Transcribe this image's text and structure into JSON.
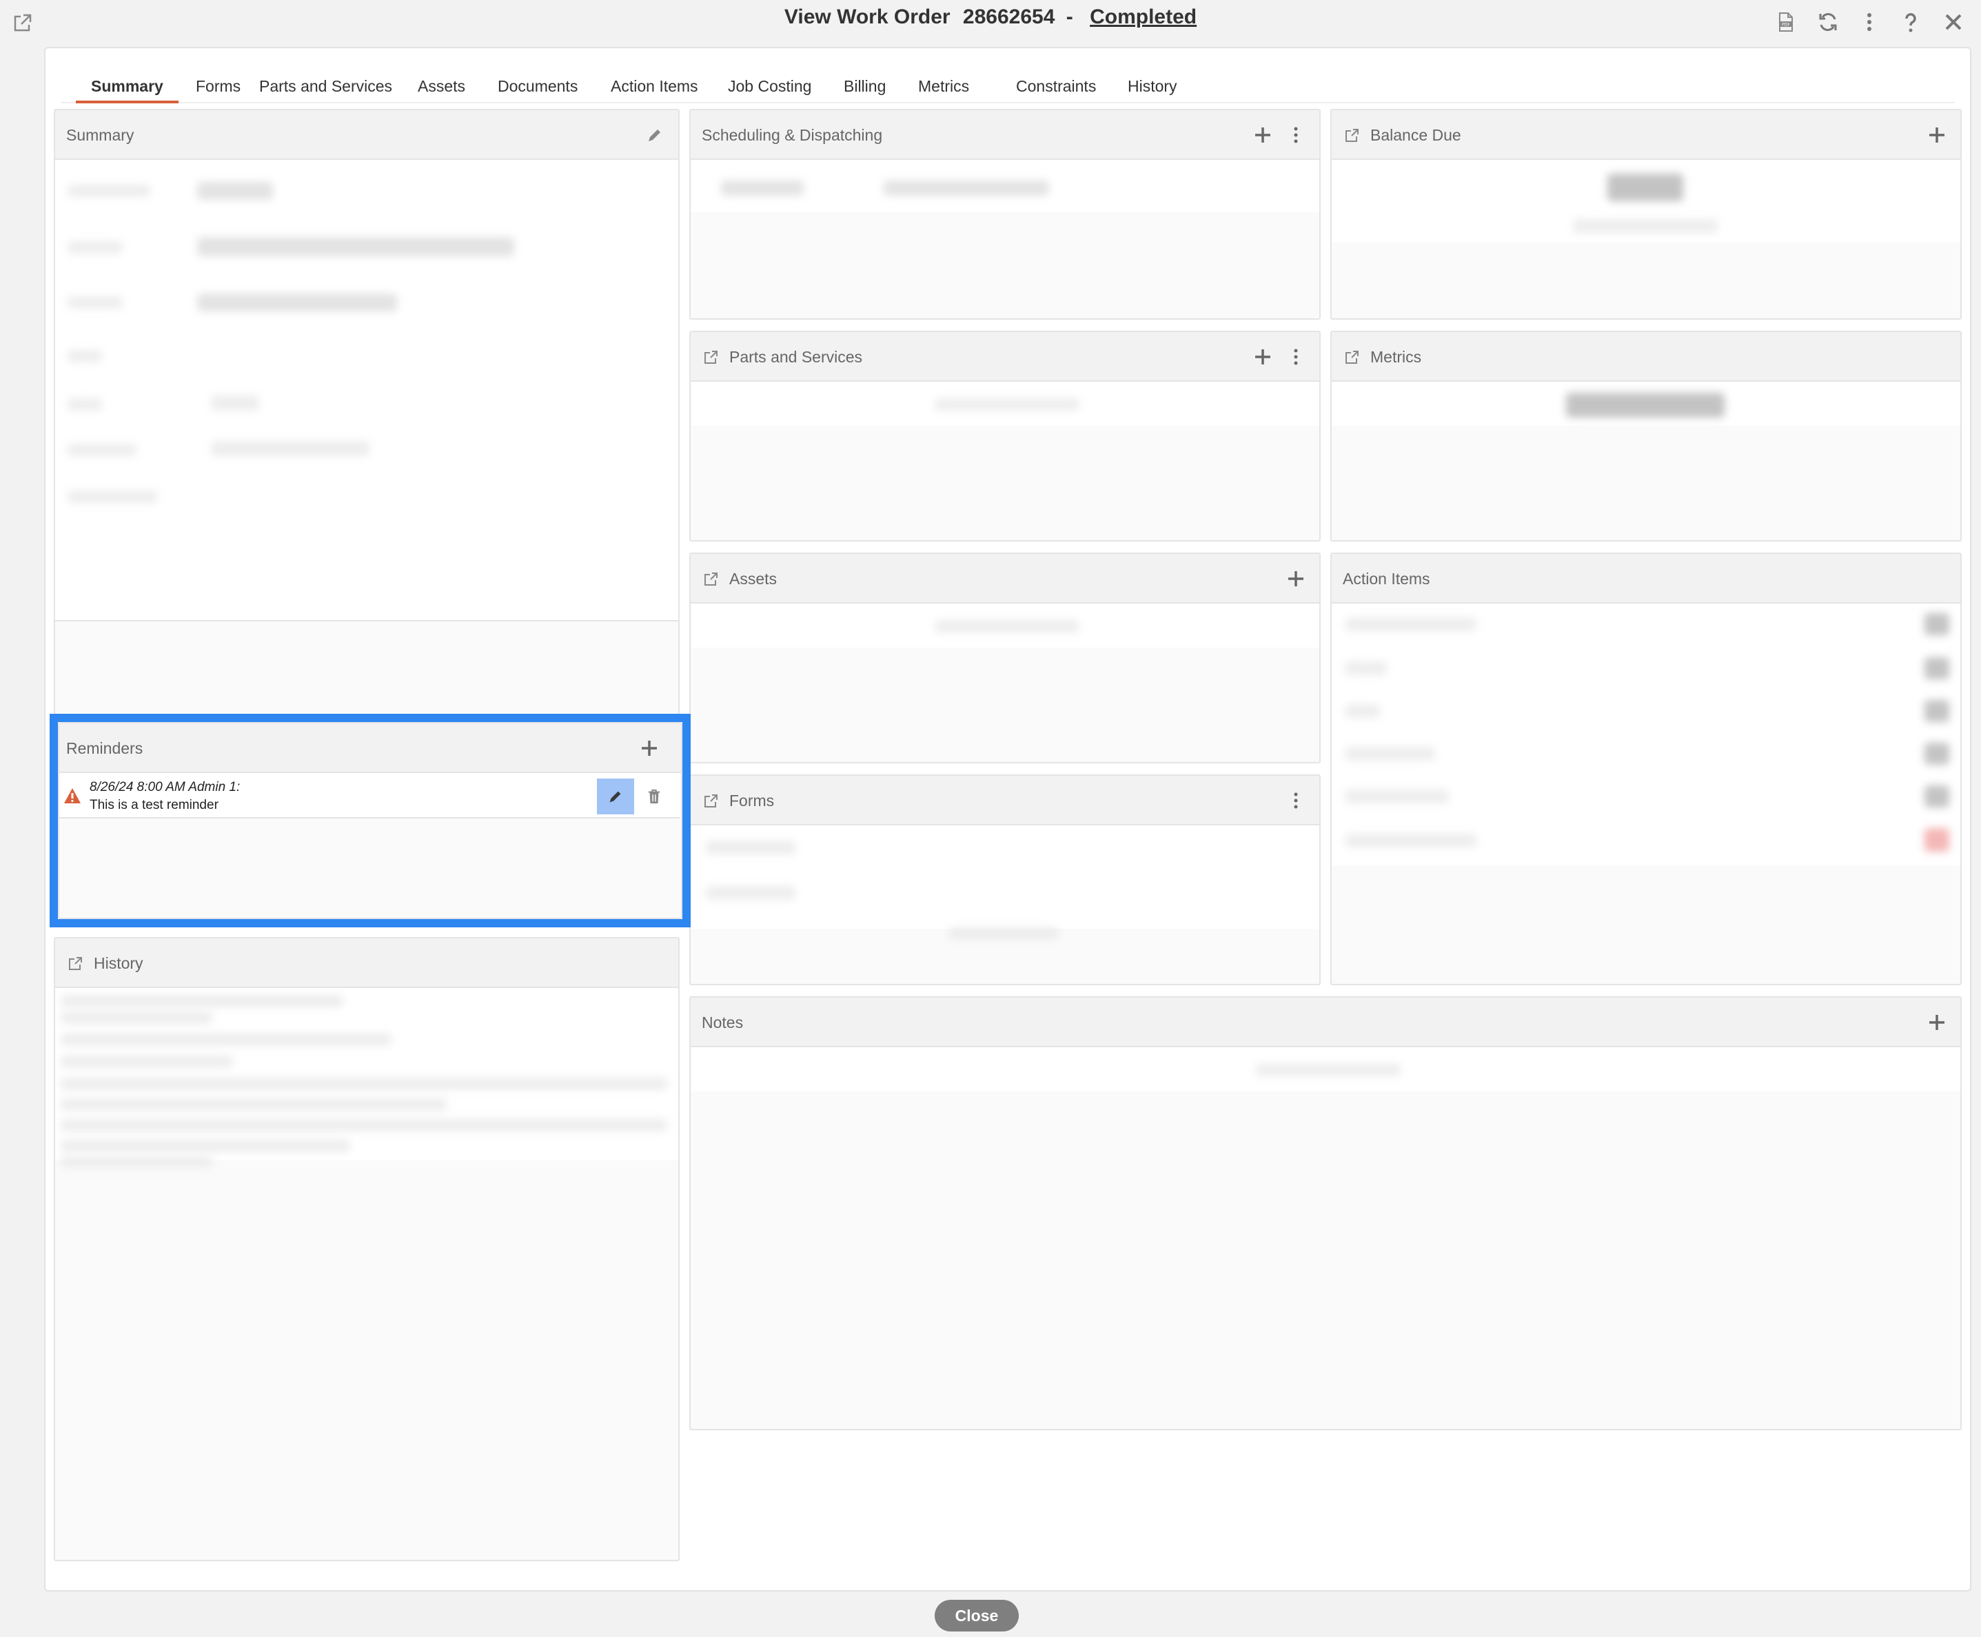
{
  "header": {
    "title_prefix": "View Work Order",
    "order_number": "28662654",
    "separator": "-",
    "status": "Completed"
  },
  "toolbar_icons": [
    "pdf-icon",
    "refresh-icon",
    "more-icon",
    "help-icon",
    "close-icon"
  ],
  "tabs": [
    {
      "label": "Summary",
      "active": true
    },
    {
      "label": "Forms"
    },
    {
      "label": "Parts and Services"
    },
    {
      "label": "Assets"
    },
    {
      "label": "Documents"
    },
    {
      "label": "Action Items"
    },
    {
      "label": "Job Costing"
    },
    {
      "label": "Billing"
    },
    {
      "label": "Metrics"
    },
    {
      "label": "Constraints"
    },
    {
      "label": "History"
    }
  ],
  "panels": {
    "summary": {
      "title": "Summary"
    },
    "scheduling": {
      "title": "Scheduling & Dispatching"
    },
    "balance": {
      "title": "Balance Due"
    },
    "parts": {
      "title": "Parts and Services"
    },
    "metrics": {
      "title": "Metrics"
    },
    "assets": {
      "title": "Assets"
    },
    "action_items": {
      "title": "Action Items"
    },
    "forms": {
      "title": "Forms"
    },
    "notes": {
      "title": "Notes"
    },
    "reminders": {
      "title": "Reminders"
    },
    "history": {
      "title": "History"
    }
  },
  "reminders": [
    {
      "line1": "8/26/24 8:00 AM Admin 1:",
      "line2": "This is a test reminder"
    }
  ],
  "colors": {
    "accent_tab": "#d9603a",
    "highlight": "#2e86f0",
    "edit_button": "#9fc3f6",
    "warning": "#d9603a"
  },
  "footer": {
    "close_label": "Close"
  }
}
